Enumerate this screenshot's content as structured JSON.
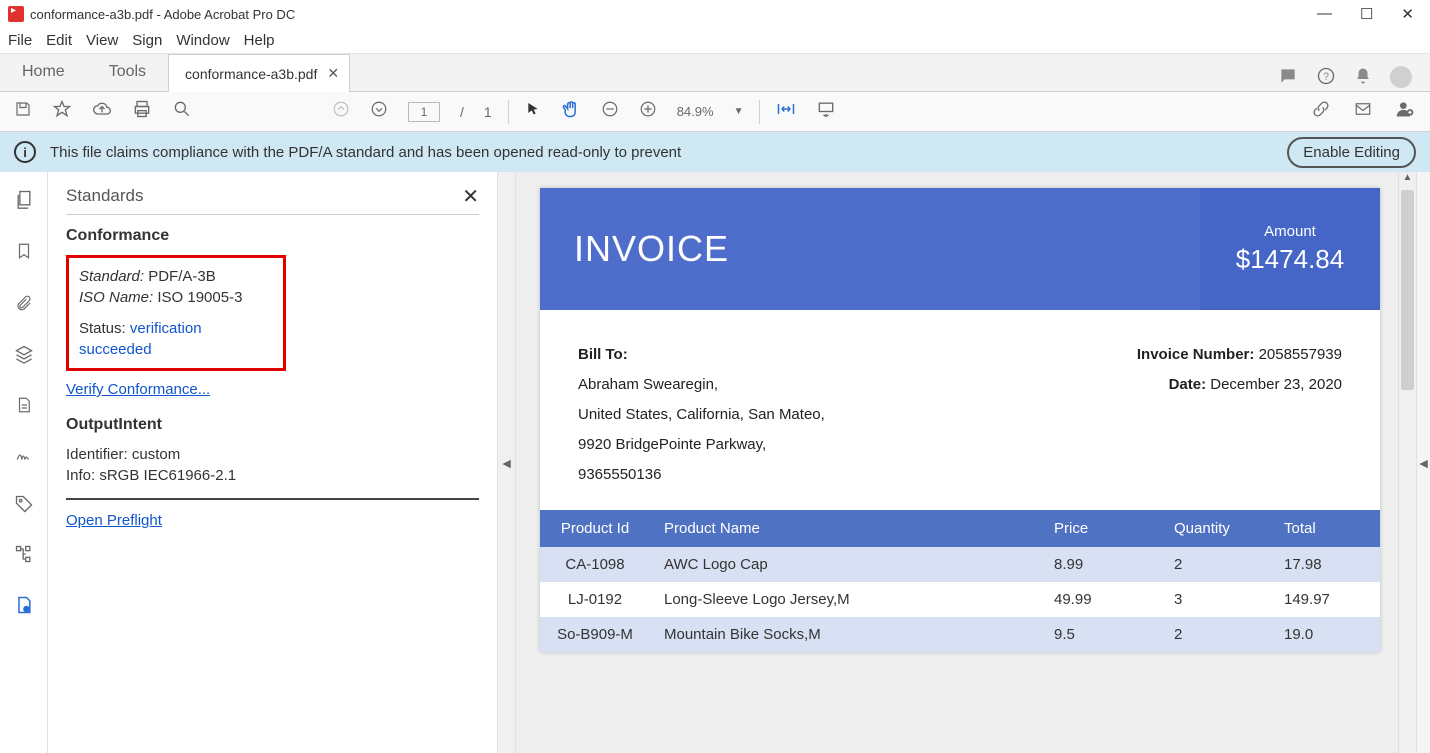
{
  "window": {
    "title": "conformance-a3b.pdf - Adobe Acrobat Pro DC"
  },
  "menu": [
    "File",
    "Edit",
    "View",
    "Sign",
    "Window",
    "Help"
  ],
  "tabs": {
    "home": "Home",
    "tools": "Tools",
    "doc": "conformance-a3b.pdf"
  },
  "toolbar": {
    "page_current": "1",
    "page_total": "1",
    "zoom": "84.9%"
  },
  "infobar": {
    "message": "This file claims compliance with the PDF/A standard and has been opened read-only to prevent",
    "button": "Enable Editing"
  },
  "standards": {
    "panel_title": "Standards",
    "conformance_title": "Conformance",
    "standard_label": "Standard:",
    "standard_value": "PDF/A-3B",
    "iso_label": "ISO Name:",
    "iso_value": "ISO 19005-3",
    "status_label": "Status:",
    "status_value": "verification succeeded",
    "verify_link": "Verify Conformance...",
    "output_title": "OutputIntent",
    "identifier": "Identifier: custom",
    "info": "Info: sRGB IEC61966-2.1",
    "preflight_link": "Open Preflight"
  },
  "invoice": {
    "title": "INVOICE",
    "amount_label": "Amount",
    "amount": "$1474.84",
    "bill_to_label": "Bill To:",
    "bill_to": [
      "Abraham Swearegin,",
      "United States, California, San Mateo,",
      "9920 BridgePointe Parkway,",
      "9365550136"
    ],
    "invoice_number_label": "Invoice Number:",
    "invoice_number": "2058557939",
    "date_label": "Date:",
    "date": "December 23, 2020",
    "columns": [
      "Product Id",
      "Product Name",
      "Price",
      "Quantity",
      "Total"
    ],
    "rows": [
      {
        "id": "CA-1098",
        "name": "AWC Logo Cap",
        "price": "8.99",
        "qty": "2",
        "total": "17.98"
      },
      {
        "id": "LJ-0192",
        "name": "Long-Sleeve Logo Jersey,M",
        "price": "49.99",
        "qty": "3",
        "total": "149.97"
      },
      {
        "id": "So-B909-M",
        "name": "Mountain Bike Socks,M",
        "price": "9.5",
        "qty": "2",
        "total": "19.0"
      }
    ]
  }
}
